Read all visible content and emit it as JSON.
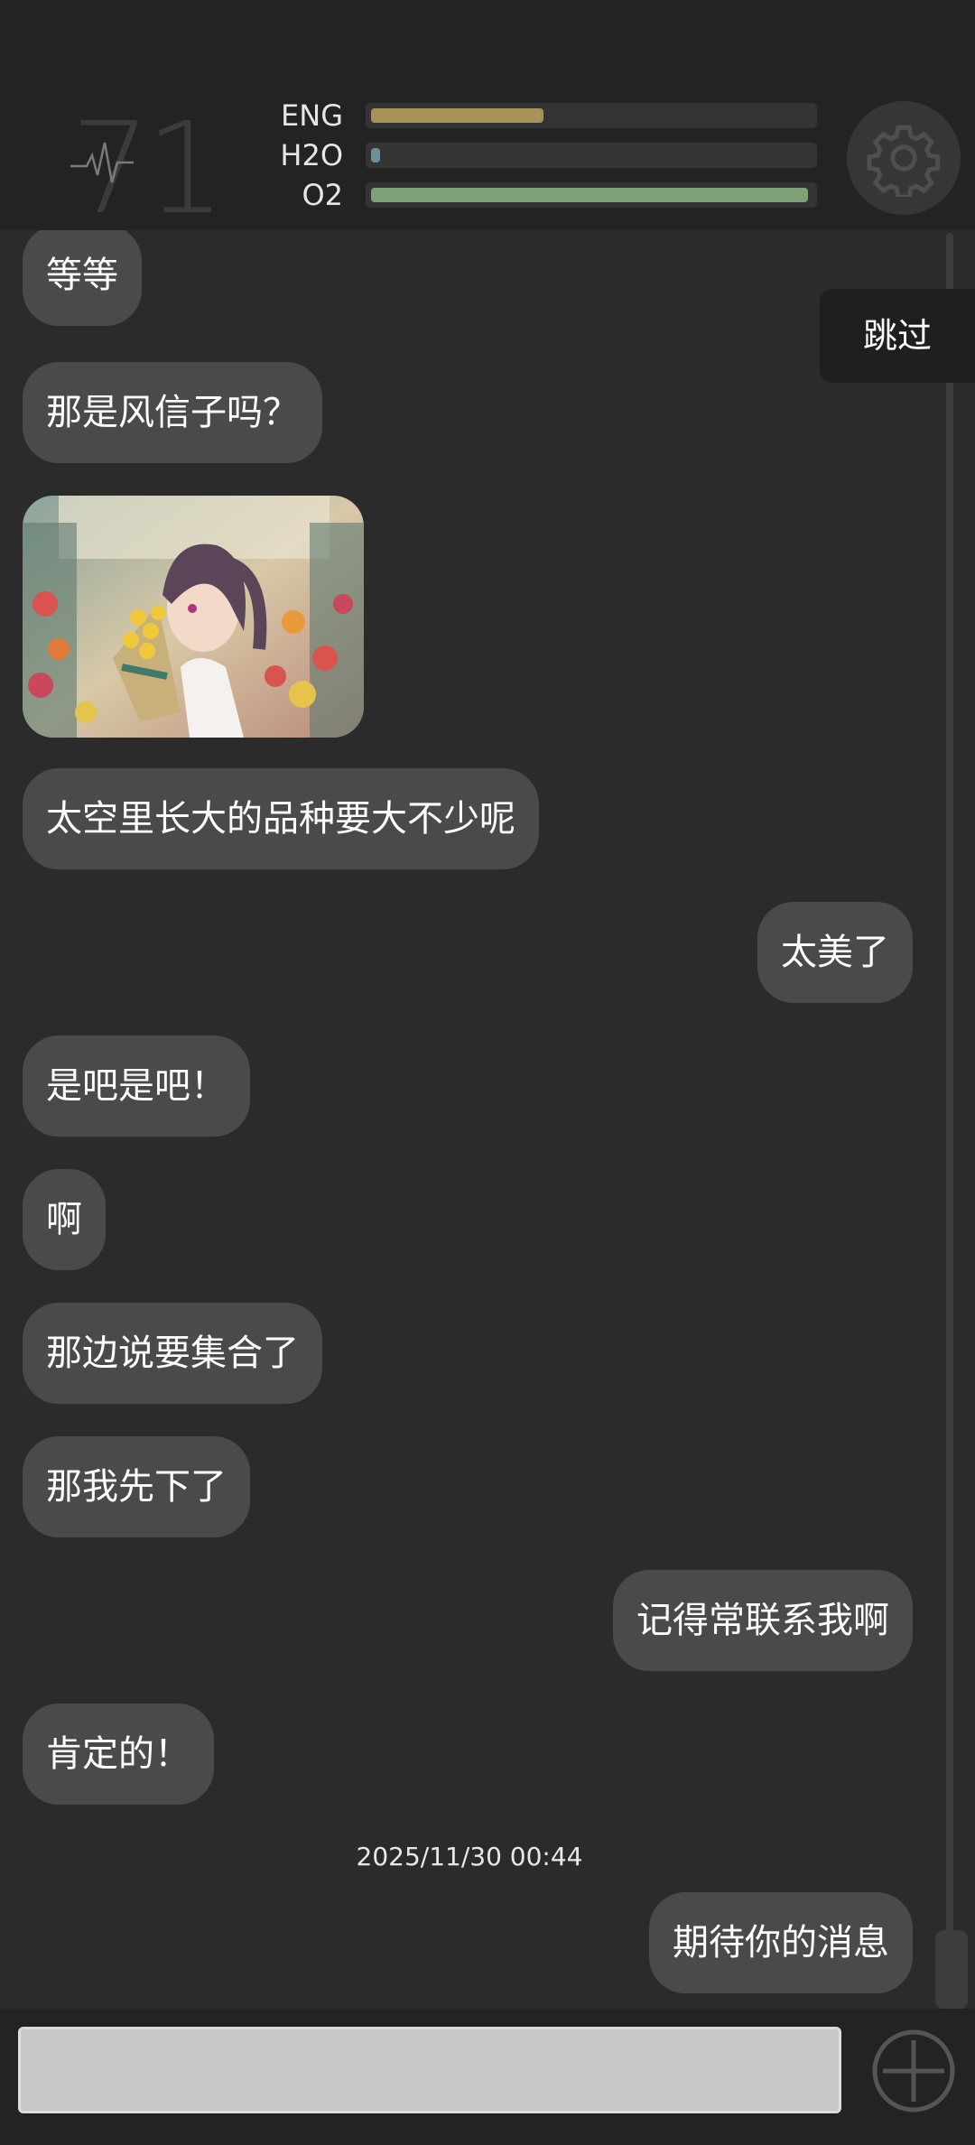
{
  "hud": {
    "counter": "71",
    "bars": [
      {
        "label": "ENG",
        "value": 0.4,
        "color": "#a8925a"
      },
      {
        "label": "H2O",
        "value": 0.02,
        "color": "#6d8d9a"
      },
      {
        "label": "O2",
        "value": 0.98,
        "color": "#7fa177"
      }
    ]
  },
  "skip_label": "跳过",
  "messages": [
    {
      "side": "left",
      "text": "等等"
    },
    {
      "side": "left",
      "text": "那是风信子吗？"
    },
    {
      "side": "left",
      "type": "image",
      "image": "girl-with-flowers-photo"
    },
    {
      "side": "left",
      "text": "太空里长大的品种要大不少呢"
    },
    {
      "side": "right",
      "text": "太美了"
    },
    {
      "side": "left",
      "text": "是吧是吧！"
    },
    {
      "side": "left",
      "text": "啊"
    },
    {
      "side": "left",
      "text": "那边说要集合了"
    },
    {
      "side": "left",
      "text": "那我先下了"
    },
    {
      "side": "right",
      "text": "记得常联系我啊"
    },
    {
      "side": "left",
      "text": "肯定的！"
    },
    {
      "side": "right",
      "text": "期待你的消息"
    }
  ],
  "timestamp": "2025/11/30  00:44",
  "input": {
    "value": "",
    "placeholder": ""
  },
  "icons": {
    "settings": "gear-icon",
    "add": "plus-circle-icon",
    "pulse": "heartbeat-icon"
  }
}
